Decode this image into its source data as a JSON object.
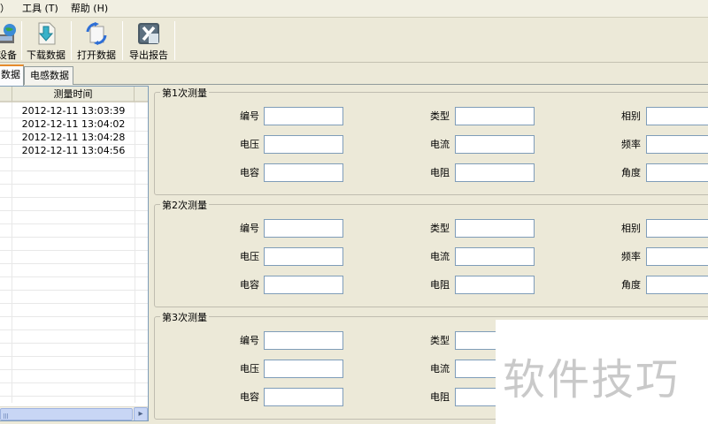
{
  "menubar": {
    "items": [
      "）",
      "工具 (T)",
      "帮助 (H)"
    ]
  },
  "toolbar": {
    "buttons": [
      {
        "label": "设备",
        "icon": "device-globe-icon"
      },
      {
        "label": "下载数据",
        "icon": "download-arrow-icon"
      },
      {
        "label": "打开数据",
        "icon": "open-refresh-icon"
      },
      {
        "label": "导出报告",
        "icon": "excel-export-icon"
      }
    ]
  },
  "tabs": [
    {
      "label": "数据",
      "active": true
    },
    {
      "label": "电感数据",
      "active": false
    }
  ],
  "list": {
    "column_header": "测量时间",
    "rows": [
      "2012-12-11 13:03:39",
      "2012-12-11 13:04:02",
      "2012-12-11 13:04:28",
      "2012-12-11 13:04:56"
    ]
  },
  "groups": [
    {
      "title": "第1次测量",
      "fields": [
        {
          "label": "编号",
          "value": ""
        },
        {
          "label": "类型",
          "value": ""
        },
        {
          "label": "相别",
          "value": ""
        },
        {
          "label": "电压",
          "value": ""
        },
        {
          "label": "电流",
          "value": ""
        },
        {
          "label": "频率",
          "value": ""
        },
        {
          "label": "电容",
          "value": ""
        },
        {
          "label": "电阻",
          "value": ""
        },
        {
          "label": "角度",
          "value": ""
        }
      ]
    },
    {
      "title": "第2次测量",
      "fields": [
        {
          "label": "编号",
          "value": ""
        },
        {
          "label": "类型",
          "value": ""
        },
        {
          "label": "相别",
          "value": ""
        },
        {
          "label": "电压",
          "value": ""
        },
        {
          "label": "电流",
          "value": ""
        },
        {
          "label": "频率",
          "value": ""
        },
        {
          "label": "电容",
          "value": ""
        },
        {
          "label": "电阻",
          "value": ""
        },
        {
          "label": "角度",
          "value": ""
        }
      ]
    },
    {
      "title": "第3次测量",
      "fields": [
        {
          "label": "编号",
          "value": ""
        },
        {
          "label": "类型",
          "value": ""
        },
        {
          "label": "电压",
          "value": ""
        },
        {
          "label": "电流",
          "value": ""
        },
        {
          "label": "电容",
          "value": ""
        },
        {
          "label": "电阻",
          "value": ""
        }
      ]
    }
  ],
  "watermark": "软件技巧",
  "colors": {
    "window_bg": "#ece9d8",
    "tab_accent": "#e68b2c",
    "field_border": "#7f9db9"
  }
}
